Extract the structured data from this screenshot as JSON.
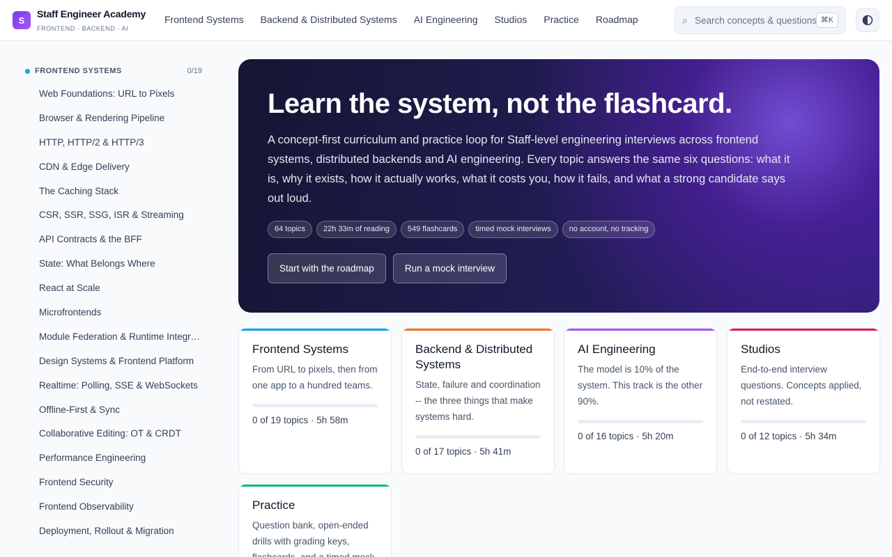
{
  "header": {
    "logo_letter": "S",
    "brand_title": "Staff Engineer Academy",
    "brand_sub": "FRONTEND · BACKEND · AI",
    "nav": [
      "Frontend Systems",
      "Backend & Distributed Systems",
      "AI Engineering",
      "Studios",
      "Practice",
      "Roadmap"
    ],
    "search_placeholder": "Search concepts & questions",
    "search_icon": "search-icon",
    "search_shortcut": "⌘K",
    "theme_icon": "contrast-icon"
  },
  "sidebar": {
    "section_title": "FRONTEND SYSTEMS",
    "progress": "0/19",
    "items": [
      "Web Foundations: URL to Pixels",
      "Browser & Rendering Pipeline",
      "HTTP, HTTP/2 & HTTP/3",
      "CDN & Edge Delivery",
      "The Caching Stack",
      "CSR, SSR, SSG, ISR & Streaming",
      "API Contracts & the BFF",
      "State: What Belongs Where",
      "React at Scale",
      "Microfrontends",
      "Module Federation & Runtime Integra…",
      "Design Systems & Frontend Platform",
      "Realtime: Polling, SSE & WebSockets",
      "Offline-First & Sync",
      "Collaborative Editing: OT & CRDT",
      "Performance Engineering",
      "Frontend Security",
      "Frontend Observability",
      "Deployment, Rollout & Migration"
    ]
  },
  "hero": {
    "title": "Learn the system, not the flashcard.",
    "description": "A concept-first curriculum and practice loop for Staff-level engineering interviews across frontend systems, distributed backends and AI engineering. Every topic answers the same six questions: what it is, why it exists, how it actually works, what it costs you, how it fails, and what a strong candidate says out loud.",
    "chips": [
      "64 topics",
      "22h 33m of reading",
      "549 flashcards",
      "timed mock interviews",
      "no account, no tracking"
    ],
    "primary_button": "Start with the roadmap",
    "secondary_button": "Run a mock interview"
  },
  "tracks": [
    {
      "title": "Frontend Systems",
      "description": "From URL to pixels, then from one app to a hundred teams.",
      "meta": "0 of 19 topics · 5h 58m",
      "progress": 0,
      "color": "#0ea5e9"
    },
    {
      "title": "Backend & Distributed Systems",
      "description": "State, failure and coordination -- the three things that make systems hard.",
      "meta": "0 of 17 topics · 5h 41m",
      "progress": 0,
      "color": "#f97316"
    },
    {
      "title": "AI Engineering",
      "description": "The model is 10% of the system. This track is the other 90%.",
      "meta": "0 of 16 topics · 5h 20m",
      "progress": 0,
      "color": "#a855f7"
    },
    {
      "title": "Studios",
      "description": "End-to-end interview questions. Concepts applied, not restated.",
      "meta": "0 of 12 topics · 5h 34m",
      "progress": 0,
      "color": "#e11d48"
    },
    {
      "title": "Practice",
      "description": "Question bank, open-ended drills with grading keys, flashcards, and a timed mock",
      "color": "#10b981"
    }
  ]
}
